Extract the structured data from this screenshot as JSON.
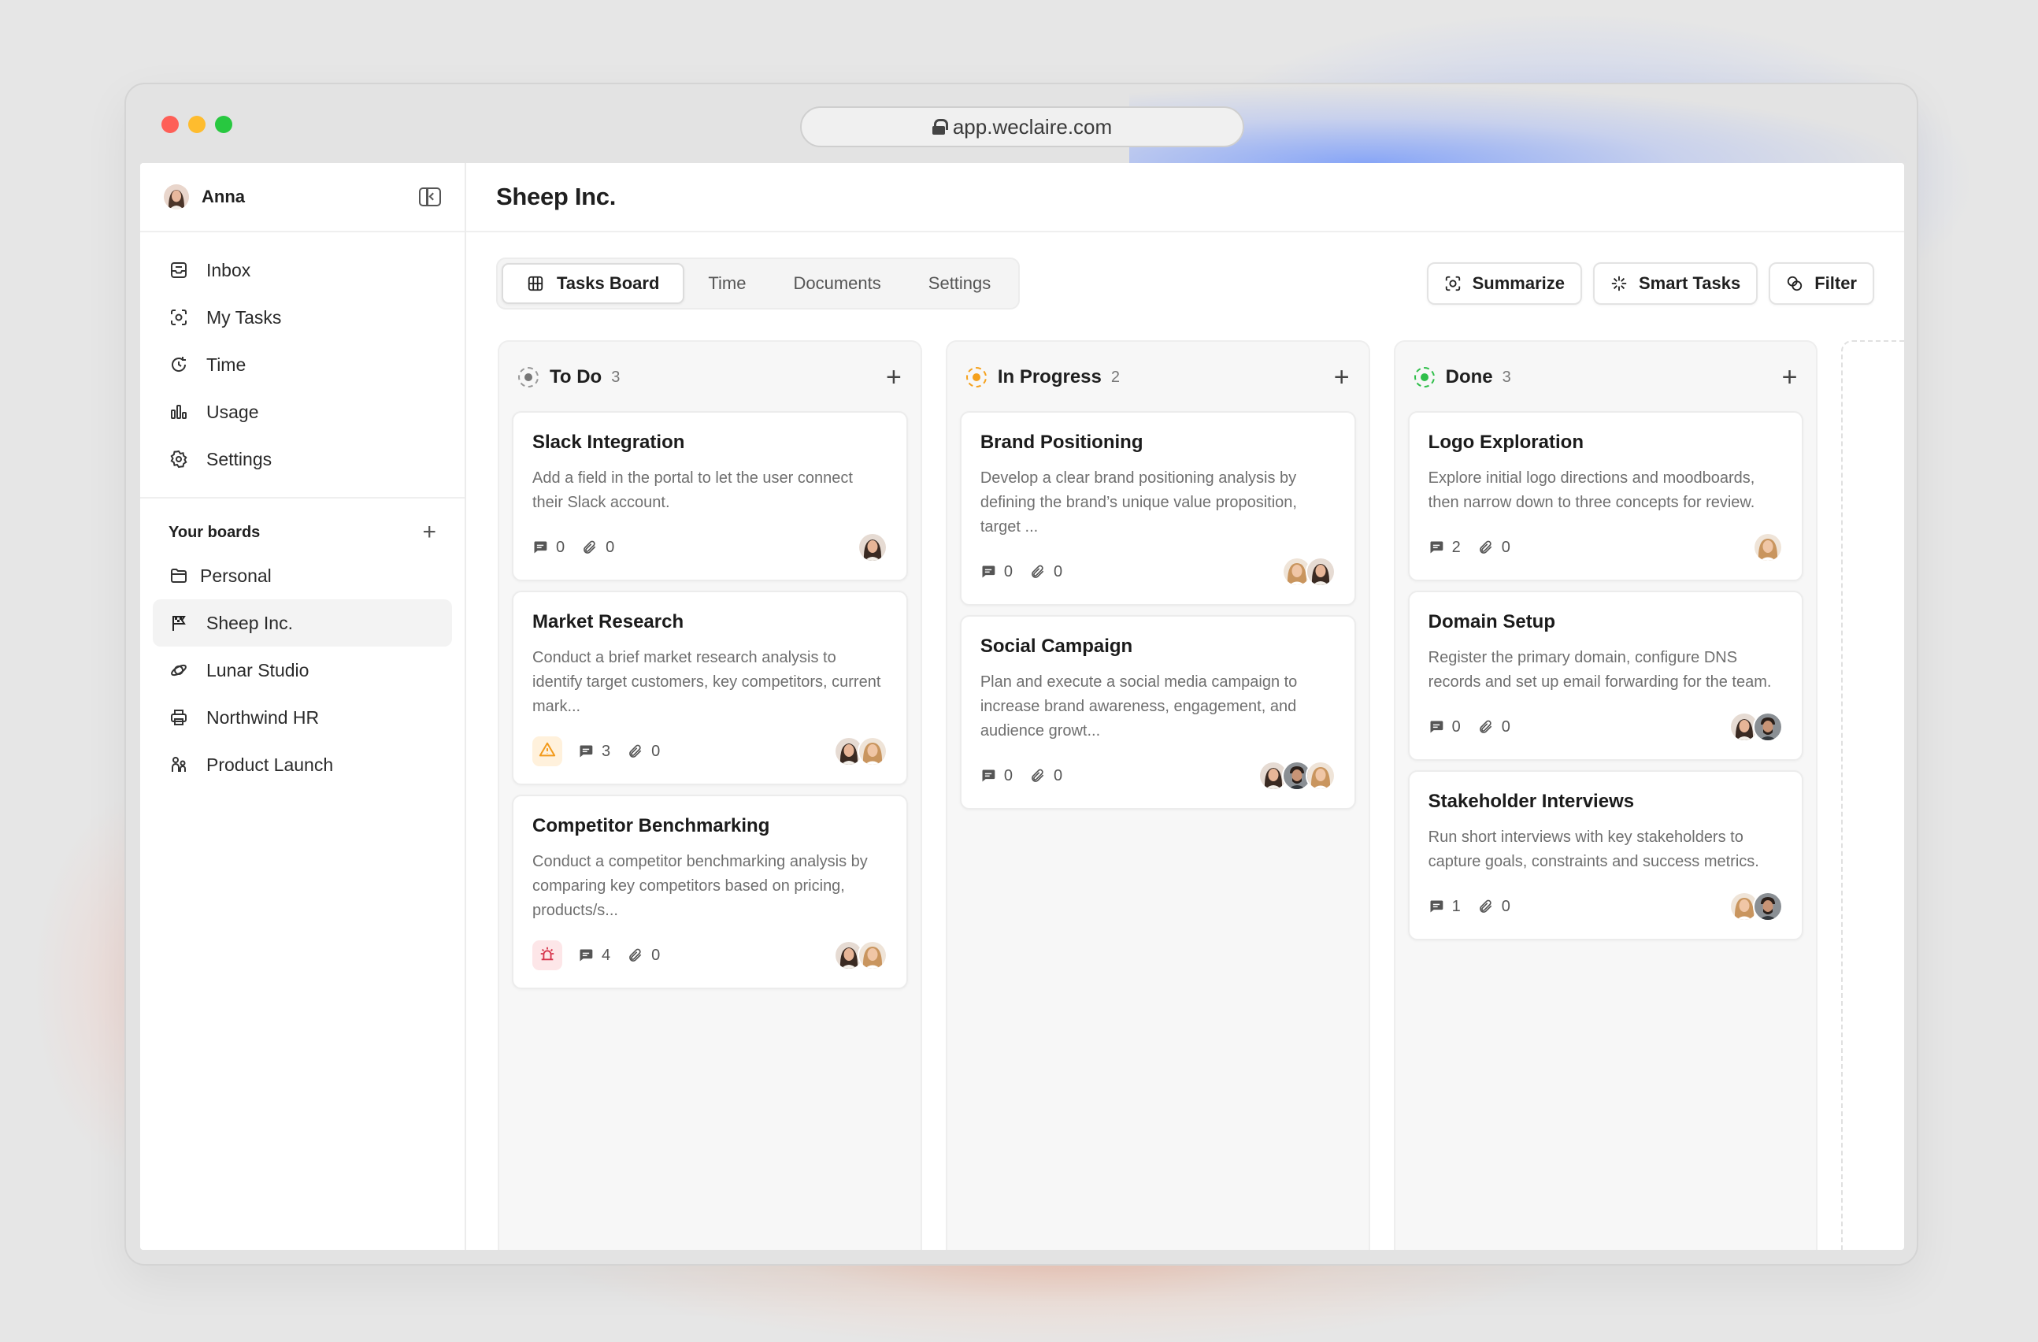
{
  "browser": {
    "url": "app.weclaire.com"
  },
  "sidebar": {
    "user": "Anna",
    "nav": [
      {
        "label": "Inbox",
        "icon": "inbox-icon"
      },
      {
        "label": "My Tasks",
        "icon": "focus-icon"
      },
      {
        "label": "Time",
        "icon": "timer-icon"
      },
      {
        "label": "Usage",
        "icon": "bar-chart-icon"
      },
      {
        "label": "Settings",
        "icon": "gear-icon"
      }
    ],
    "boards_heading": "Your boards",
    "boards": [
      {
        "label": "Personal",
        "icon": "folder-icon",
        "active": false
      },
      {
        "label": "Sheep Inc.",
        "icon": "flag-icon",
        "active": true
      },
      {
        "label": "Lunar Studio",
        "icon": "orbit-icon",
        "active": false
      },
      {
        "label": "Northwind HR",
        "icon": "printer-icon",
        "active": false
      },
      {
        "label": "Product Launch",
        "icon": "people-icon",
        "active": false
      }
    ]
  },
  "main": {
    "title": "Sheep Inc.",
    "tabs": [
      {
        "label": "Tasks Board",
        "active": true
      },
      {
        "label": "Time",
        "active": false
      },
      {
        "label": "Documents",
        "active": false
      },
      {
        "label": "Settings",
        "active": false
      }
    ],
    "actions": {
      "summarize": "Summarize",
      "smart_tasks": "Smart Tasks",
      "filter": "Filter"
    }
  },
  "columns": [
    {
      "title": "To Do",
      "count": "3",
      "status_color": "#8a8a8a",
      "cards": [
        {
          "title": "Slack Integration",
          "desc": "Add a field in the portal to let the user connect their Slack account.",
          "comments": "0",
          "attachments": "0",
          "badge": "",
          "avatars": 1
        },
        {
          "title": "Market Research",
          "desc": "Conduct a brief market research analysis to identify target customers, key competitors, current mark...",
          "comments": "3",
          "attachments": "0",
          "badge": "warning",
          "avatars": 2
        },
        {
          "title": "Competitor Benchmarking",
          "desc": "Conduct a competitor benchmarking analysis by comparing key competitors based on pricing, products/s...",
          "comments": "4",
          "attachments": "0",
          "badge": "bug",
          "avatars": 2
        }
      ]
    },
    {
      "title": "In Progress",
      "count": "2",
      "status_color": "#f5a11c",
      "cards": [
        {
          "title": "Brand Positioning",
          "desc": "Develop a clear brand positioning analysis by defining the brand’s unique value proposition, target ...",
          "comments": "0",
          "attachments": "0",
          "badge": "",
          "avatars": 2
        },
        {
          "title": "Social Campaign",
          "desc": "Plan and execute a social media campaign to increase brand awareness, engagement, and audience growt...",
          "comments": "0",
          "attachments": "0",
          "badge": "",
          "avatars": 3
        }
      ]
    },
    {
      "title": "Done",
      "count": "3",
      "status_color": "#2fbf4a",
      "cards": [
        {
          "title": "Logo Exploration",
          "desc": "Explore initial logo directions and moodboards, then narrow down to three concepts for review.",
          "comments": "2",
          "attachments": "0",
          "badge": "",
          "avatars": 1
        },
        {
          "title": "Domain Setup",
          "desc": "Register the primary domain, configure DNS records and set up email forwarding for the team.",
          "comments": "0",
          "attachments": "0",
          "badge": "",
          "avatars": 2
        },
        {
          "title": "Stakeholder Interviews",
          "desc": "Run short interviews with key stakeholders to capture goals, constraints and success metrics.",
          "comments": "1",
          "attachments": "0",
          "badge": "",
          "avatars": 2
        }
      ]
    }
  ]
}
